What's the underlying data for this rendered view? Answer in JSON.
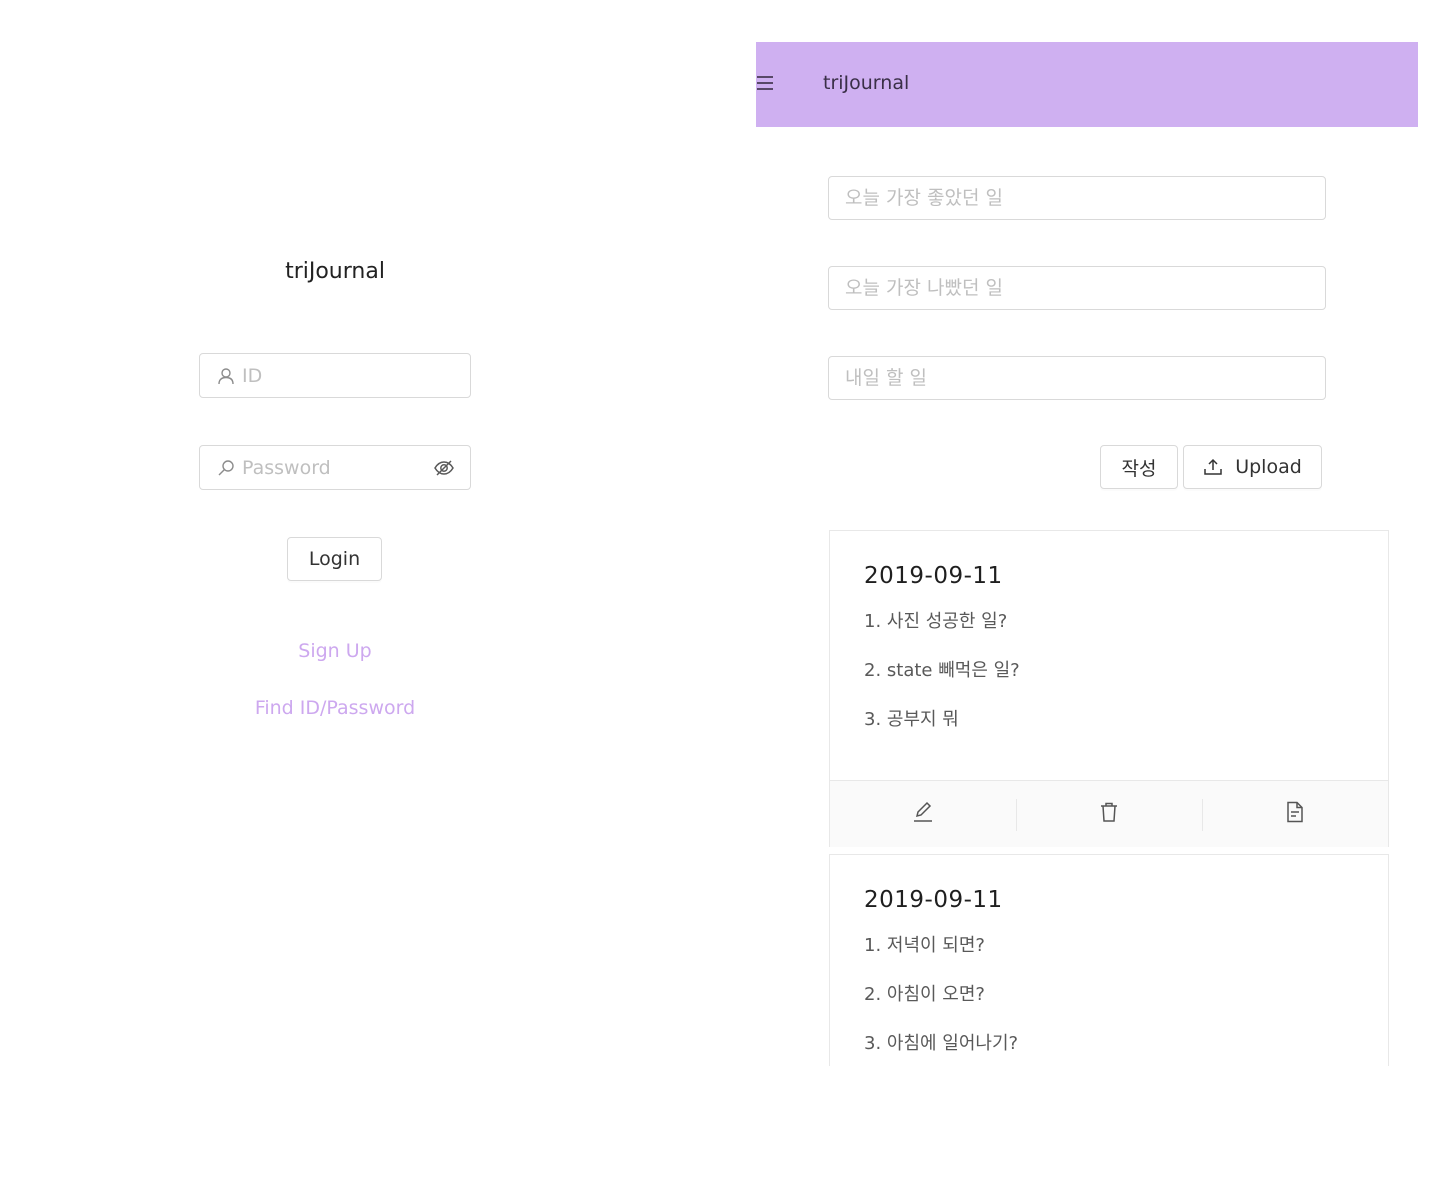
{
  "login": {
    "title": "triJournal",
    "id_placeholder": "ID",
    "password_placeholder": "Password",
    "login_label": "Login",
    "signup_label": "Sign Up",
    "find_label": "Find ID/Password"
  },
  "journal": {
    "header_title": "triJournal",
    "good_placeholder": "오늘 가장 좋았던 일",
    "bad_placeholder": "오늘 가장 나빴던 일",
    "todo_placeholder": "내일 할 일",
    "write_label": "작성",
    "upload_label": "Upload",
    "entries": [
      {
        "date": "2019-09-11",
        "lines": [
          "1. 사진 성공한 일?",
          "2. state 빼먹은 일?",
          "3. 공부지 뭐"
        ]
      },
      {
        "date": "2019-09-11",
        "lines": [
          "1. 저녁이 되면?",
          "2. 아침이 오면?",
          "3. 아침에 일어나기?"
        ]
      }
    ]
  },
  "colors": {
    "accent": "#cfb0f1",
    "link": "#cda8ef"
  },
  "icons": [
    "user-icon",
    "search-icon",
    "eye-invisible-icon",
    "menu-icon",
    "upload-icon",
    "edit-icon",
    "delete-icon",
    "file-icon"
  ]
}
